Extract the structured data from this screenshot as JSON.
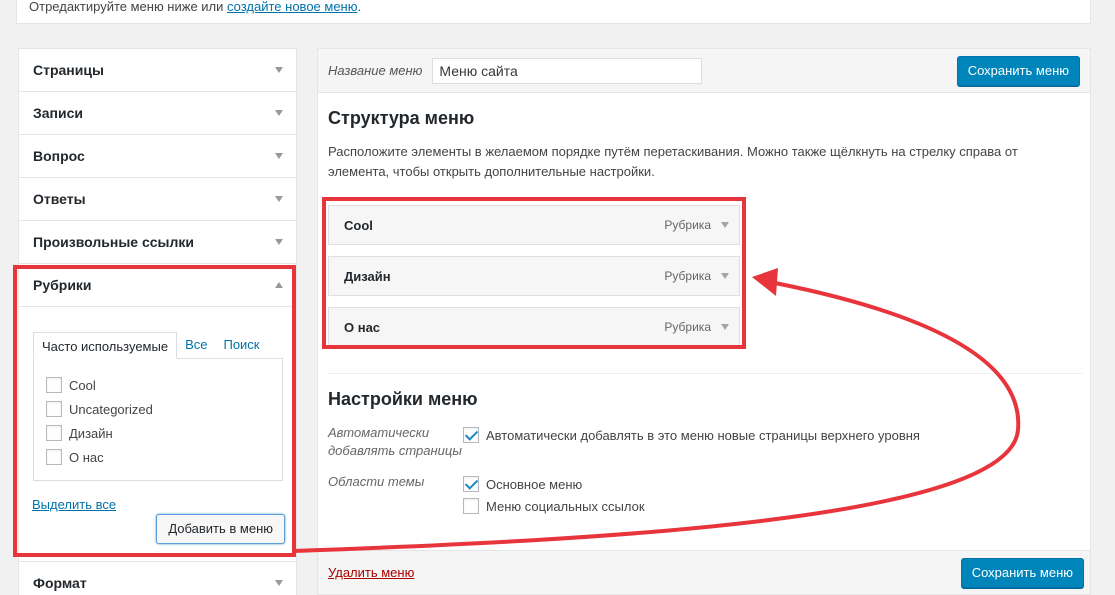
{
  "top": {
    "text": "Отредактируйте меню ниже или ",
    "link": "создайте новое меню",
    "suffix": "."
  },
  "accordion": {
    "items": [
      {
        "label": "Страницы"
      },
      {
        "label": "Записи"
      },
      {
        "label": "Вопрос"
      },
      {
        "label": "Ответы"
      },
      {
        "label": "Произвольные ссылки"
      }
    ],
    "open_section": {
      "label": "Рубрики",
      "tabs": [
        "Часто используемые",
        "Все",
        "Поиск"
      ],
      "checkboxes": [
        "Cool",
        "Uncategorized",
        "Дизайн",
        "О нас"
      ],
      "select_all": "Выделить все",
      "add_button": "Добавить в меню"
    },
    "after": [
      {
        "label": "Формат"
      }
    ]
  },
  "menu": {
    "name_label": "Название меню",
    "name_value": "Меню сайта",
    "save_label": "Сохранить меню",
    "structure_title": "Структура меню",
    "structure_desc": "Расположите элементы в желаемом порядке путём перетаскивания. Можно также щёлкнуть на стрелку справа от элемента, чтобы открыть дополнительные настройки.",
    "items": [
      {
        "title": "Cool",
        "type": "Рубрика"
      },
      {
        "title": "Дизайн",
        "type": "Рубрика"
      },
      {
        "title": "О нас",
        "type": "Рубрика"
      }
    ],
    "settings_title": "Настройки меню",
    "auto_add_label": "Автоматически добавлять страницы",
    "auto_add_option": "Автоматически добавлять в это меню новые страницы верхнего уровня",
    "theme_locations_label": "Области темы",
    "theme_locations": [
      {
        "label": "Основное меню",
        "checked": true
      },
      {
        "label": "Меню социальных ссылок",
        "checked": false
      }
    ],
    "delete_label": "Удалить меню"
  },
  "colors": {
    "accent": "#0085ba",
    "annotation": "#e8343b"
  }
}
